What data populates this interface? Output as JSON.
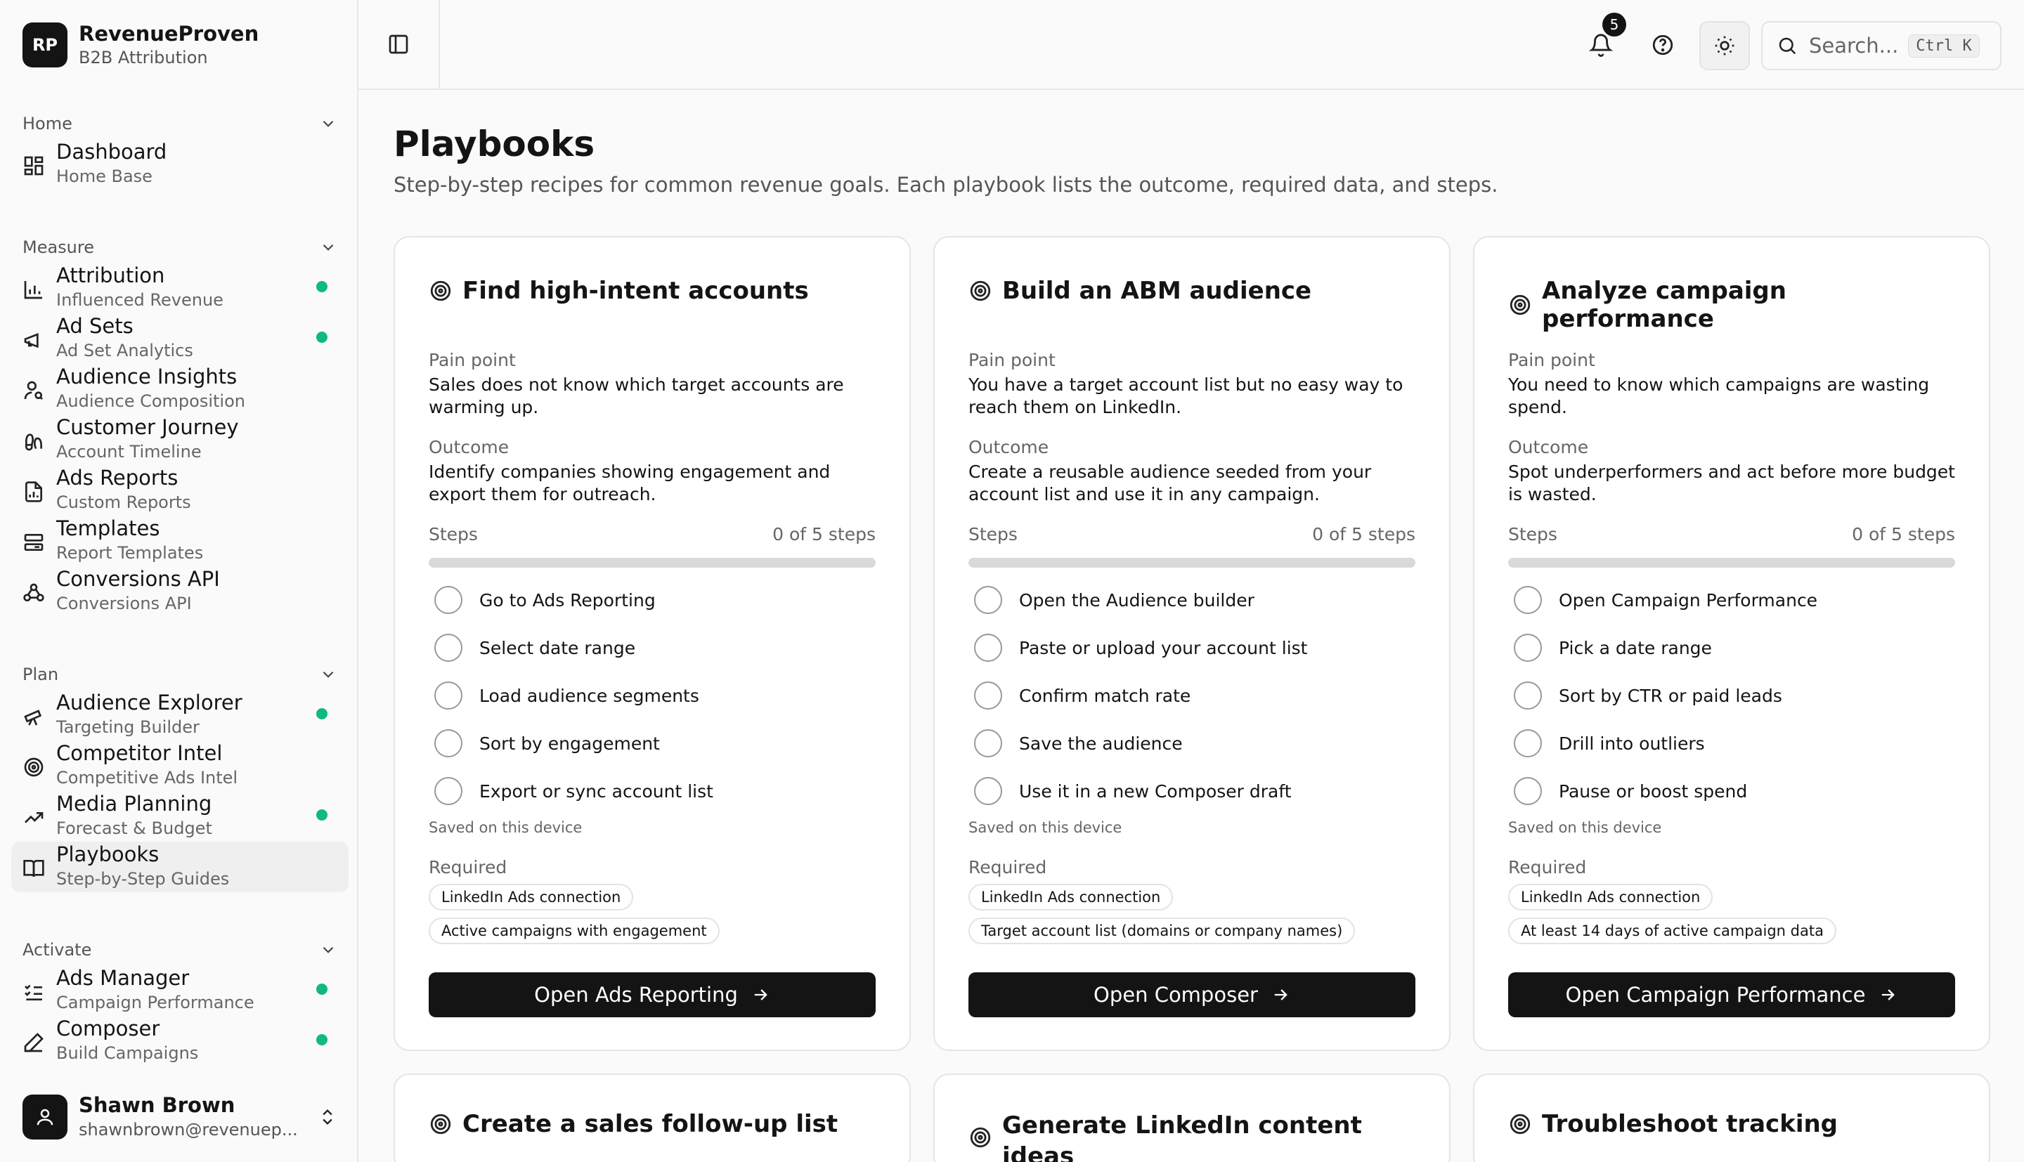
{
  "brand": {
    "logo": "RP",
    "name": "RevenueProven",
    "subtitle": "B2B Attribution"
  },
  "sidebar": {
    "groups": [
      {
        "label": "Home",
        "items": [
          {
            "label": "Dashboard",
            "sub": "Home Base",
            "icon": "dashboard-icon",
            "dot": false
          }
        ]
      },
      {
        "label": "Measure",
        "items": [
          {
            "label": "Attribution",
            "sub": "Influenced Revenue",
            "icon": "bar-chart-icon",
            "dot": true
          },
          {
            "label": "Ad Sets",
            "sub": "Ad Set Analytics",
            "icon": "megaphone-icon",
            "dot": true
          },
          {
            "label": "Audience Insights",
            "sub": "Audience Composition",
            "icon": "user-search-icon",
            "dot": false
          },
          {
            "label": "Customer Journey",
            "sub": "Account Timeline",
            "icon": "footprints-icon",
            "dot": false
          },
          {
            "label": "Ads Reports",
            "sub": "Custom Reports",
            "icon": "file-chart-icon",
            "dot": false
          },
          {
            "label": "Templates",
            "sub": "Report Templates",
            "icon": "templates-icon",
            "dot": false
          },
          {
            "label": "Conversions API",
            "sub": "Conversions API",
            "icon": "webhook-icon",
            "dot": false
          }
        ]
      },
      {
        "label": "Plan",
        "items": [
          {
            "label": "Audience Explorer",
            "sub": "Targeting Builder",
            "icon": "telescope-icon",
            "dot": true
          },
          {
            "label": "Competitor Intel",
            "sub": "Competitive Ads Intel",
            "icon": "target-icon",
            "dot": false
          },
          {
            "label": "Media Planning",
            "sub": "Forecast & Budget",
            "icon": "trending-up-icon",
            "dot": true
          },
          {
            "label": "Playbooks",
            "sub": "Step-by-Step Guides",
            "icon": "book-open-icon",
            "dot": false,
            "active": true
          }
        ]
      },
      {
        "label": "Activate",
        "items": [
          {
            "label": "Ads Manager",
            "sub": "Campaign Performance",
            "icon": "list-checks-icon",
            "dot": true
          },
          {
            "label": "Composer",
            "sub": "Build Campaigns",
            "icon": "pen-icon",
            "dot": true
          }
        ]
      }
    ]
  },
  "user": {
    "name": "Shawn Brown",
    "email": "shawnbrown@revenuep..."
  },
  "topbar": {
    "notifications": "5",
    "search_placeholder": "Search...",
    "search_shortcut": "Ctrl K"
  },
  "page": {
    "title": "Playbooks",
    "subtitle": "Step-by-step recipes for common revenue goals. Each playbook lists the outcome, required data, and steps."
  },
  "labels": {
    "pain_point": "Pain point",
    "outcome": "Outcome",
    "steps": "Steps",
    "saved": "Saved on this device",
    "required": "Required"
  },
  "playbooks": [
    {
      "title": "Find high-intent accounts",
      "pain": "Sales does not know which target accounts are warming up.",
      "outcome": "Identify companies showing engagement and export them for outreach.",
      "steps_done": 0,
      "steps_count": "0 of 5 steps",
      "steps": [
        "Go to Ads Reporting",
        "Select date range",
        "Load audience segments",
        "Sort by engagement",
        "Export or sync account list"
      ],
      "required": [
        "LinkedIn Ads connection",
        "Active campaigns with engagement"
      ],
      "cta": "Open Ads Reporting"
    },
    {
      "title": "Build an ABM audience",
      "pain": "You have a target account list but no easy way to reach them on LinkedIn.",
      "outcome": "Create a reusable audience seeded from your account list and use it in any campaign.",
      "steps_done": 0,
      "steps_count": "0 of 5 steps",
      "steps": [
        "Open the Audience builder",
        "Paste or upload your account list",
        "Confirm match rate",
        "Save the audience",
        "Use it in a new Composer draft"
      ],
      "required": [
        "LinkedIn Ads connection",
        "Target account list (domains or company names)"
      ],
      "cta": "Open Composer"
    },
    {
      "title": "Analyze campaign performance",
      "pain": "You need to know which campaigns are wasting spend.",
      "outcome": "Spot underperformers and act before more budget is wasted.",
      "steps_done": 0,
      "steps_count": "0 of 5 steps",
      "steps": [
        "Open Campaign Performance",
        "Pick a date range",
        "Sort by CTR or paid leads",
        "Drill into outliers",
        "Pause or boost spend"
      ],
      "required": [
        "LinkedIn Ads connection",
        "At least 14 days of active campaign data"
      ],
      "cta": "Open Campaign Performance"
    }
  ],
  "playbooks_row2": [
    {
      "title": "Create a sales follow-up list"
    },
    {
      "title": "Generate LinkedIn content ideas"
    },
    {
      "title": "Troubleshoot tracking"
    }
  ]
}
